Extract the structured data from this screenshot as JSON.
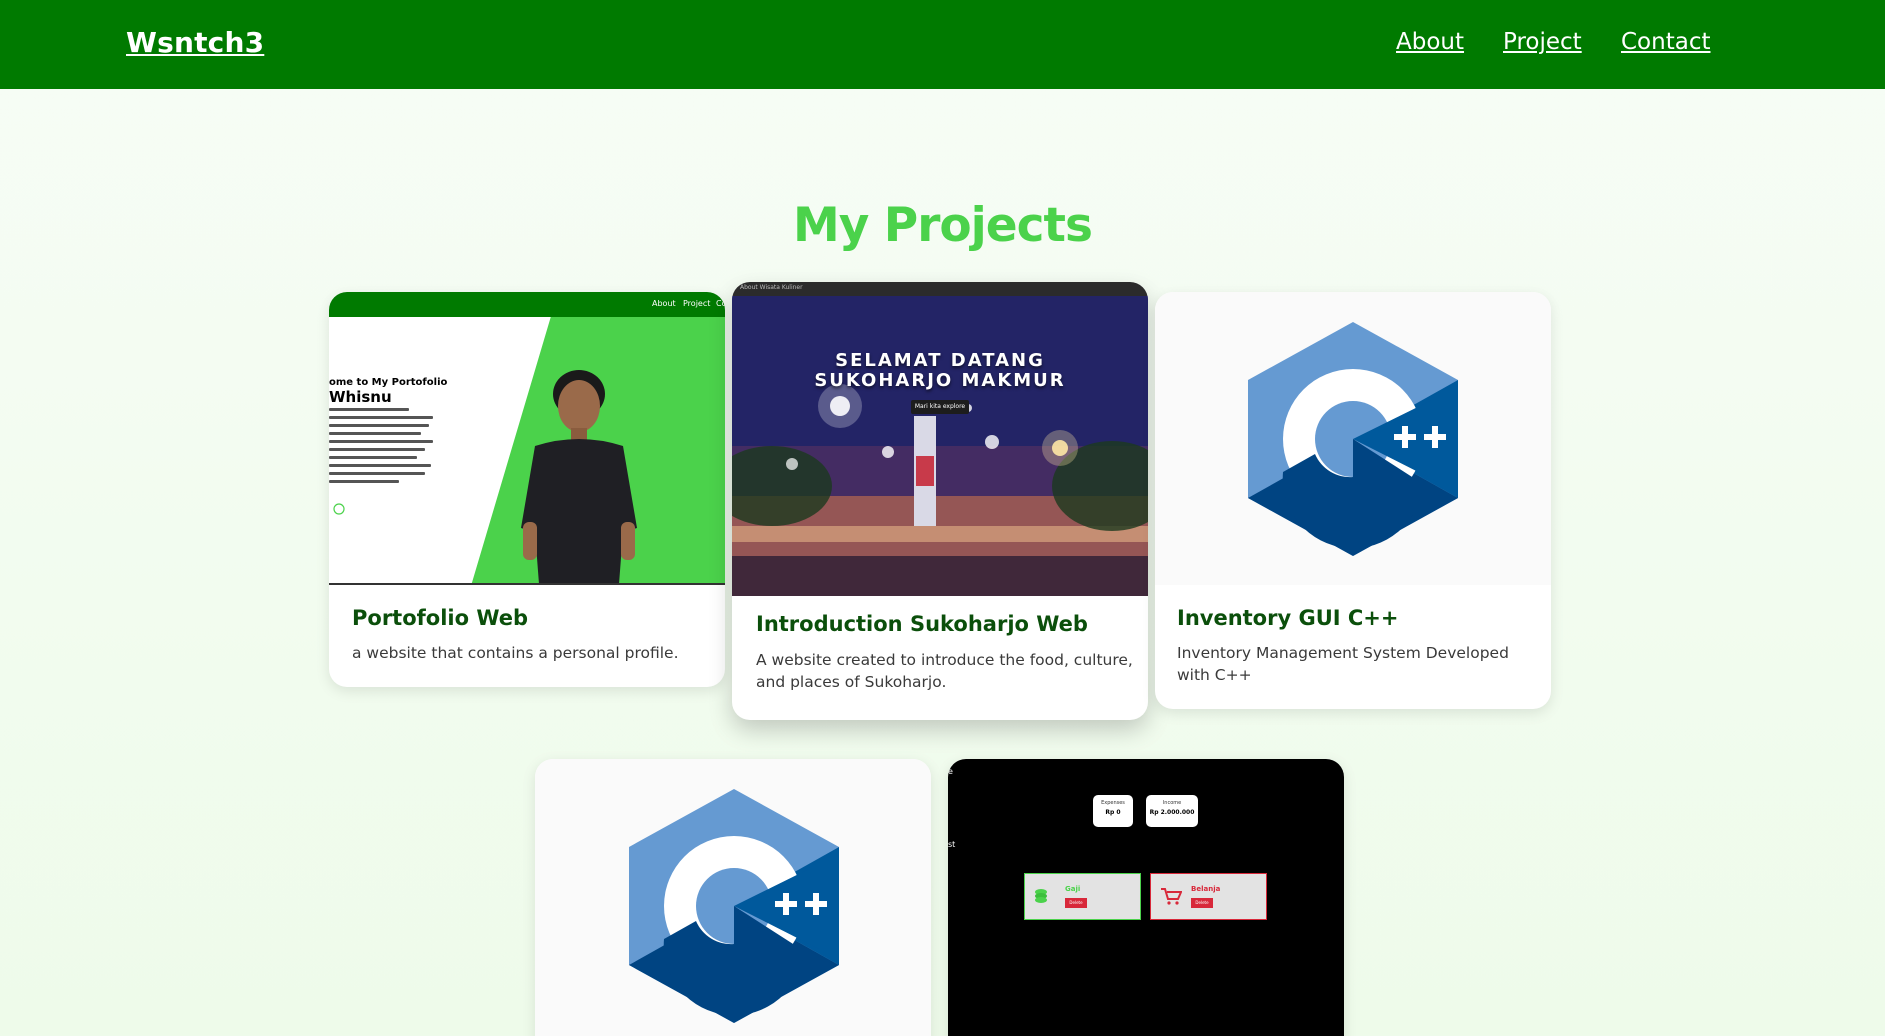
{
  "navbar": {
    "brand": "Wsntch3",
    "links": [
      "About",
      "Project",
      "Contact"
    ]
  },
  "section": {
    "title": "My Projects"
  },
  "projects": [
    {
      "title": "Portofolio Web",
      "description": "a website that contains a personal profile.",
      "thumb": {
        "nav": [
          "About",
          "Project",
          "Co"
        ],
        "heading": "ome to My Portofolio",
        "name": "Whisnu"
      }
    },
    {
      "title": "Introduction Sukoharjo Web",
      "description": "A website created to introduce the food, culture, and places of Sukoharjo.",
      "thumb": {
        "bar": "About   Wisata   Kuliner",
        "line1": "SELAMAT DATANG",
        "line2": "SUKOHARJO MAKMUR",
        "button": "Mari kita explore"
      }
    },
    {
      "title": "Inventory GUI C++",
      "description": "Inventory Management System Developed with C++",
      "thumb": {
        "logo": "c++-logo"
      }
    },
    {
      "title": "",
      "description": "",
      "thumb": {
        "logo": "c++-logo"
      }
    },
    {
      "title": "",
      "description": "",
      "thumb": {
        "expense_label": "Expenses",
        "expense_value": "Rp 0",
        "income_label": "Income",
        "income_value": "Rp 2.000.000",
        "income_item": "Gaji",
        "expense_item": "Belanja",
        "delete": "Delete"
      }
    }
  ],
  "colors": {
    "nav_bg": "#007a00",
    "accent": "#4bd24b",
    "title_green": "#0b4f0b",
    "cpp_light": "#659ad2",
    "cpp_dark": "#004482",
    "danger": "#d8283a"
  }
}
